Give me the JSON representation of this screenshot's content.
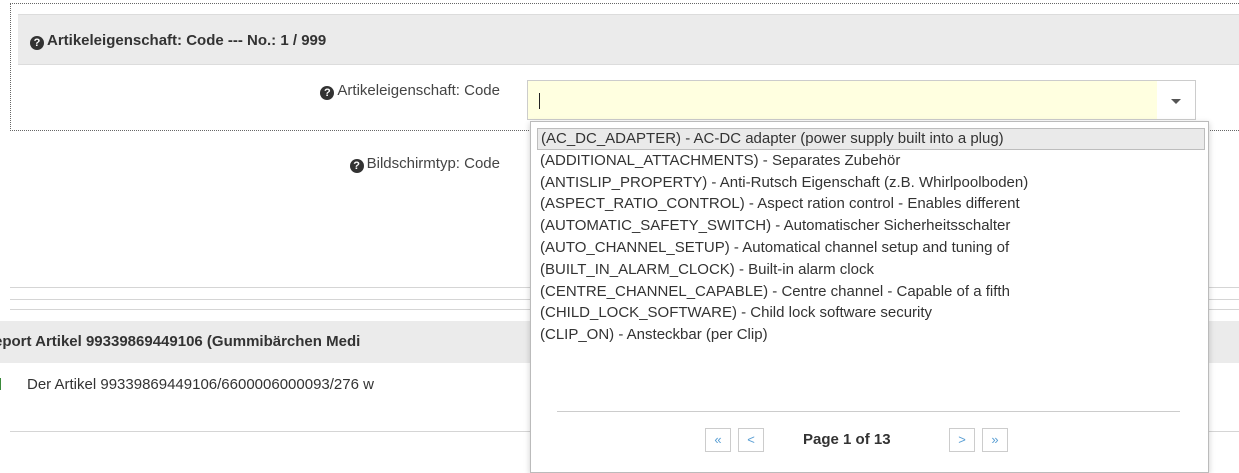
{
  "fieldset": {
    "title": "Artikeleigenschaft: Code --- No.: 1 / 999"
  },
  "form": {
    "code_label": "Artikeleigenschaft: Code",
    "screen_label": "Bildschirmtyp: Code",
    "code_value": ""
  },
  "dropdown": {
    "options": [
      "(AC_DC_ADAPTER) - AC-DC adapter (power supply built into a plug)",
      "(ADDITIONAL_ATTACHMENTS) - Separates Zubehör",
      "(ANTISLIP_PROPERTY) - Anti-Rutsch Eigenschaft (z.B. Whirlpoolboden)",
      "(ASPECT_RATIO_CONTROL) - Aspect ration control - Enables different",
      "(AUTOMATIC_SAFETY_SWITCH) - Automatischer Sicherheitsschalter",
      "(AUTO_CHANNEL_SETUP) - Automatical channel setup and tuning of",
      "(BUILT_IN_ALARM_CLOCK) - Built-in alarm clock",
      "(CENTRE_CHANNEL_CAPABLE) - Centre channel - Capable of a fifth",
      "(CHILD_LOCK_SOFTWARE) - Child lock software security",
      "(CLIP_ON) - Ansteckbar (per Clip)"
    ],
    "selected_index": 0,
    "pager": {
      "first": "«",
      "prev": "<",
      "label": "Page 1 of 13",
      "next": ">",
      "last": "»"
    }
  },
  "report": {
    "title": "eport Artikel 99339869449106 (Gummibärchen Medi",
    "message": "Der Artikel 99339869449106/6600006000093/276 w"
  },
  "icons": {
    "help": "question-circle-icon",
    "status": "success-indicator-icon"
  },
  "colors": {
    "input_bg": "#ffffe0",
    "header_bg": "#ebebeb",
    "pager_link": "#5a9fd4"
  }
}
